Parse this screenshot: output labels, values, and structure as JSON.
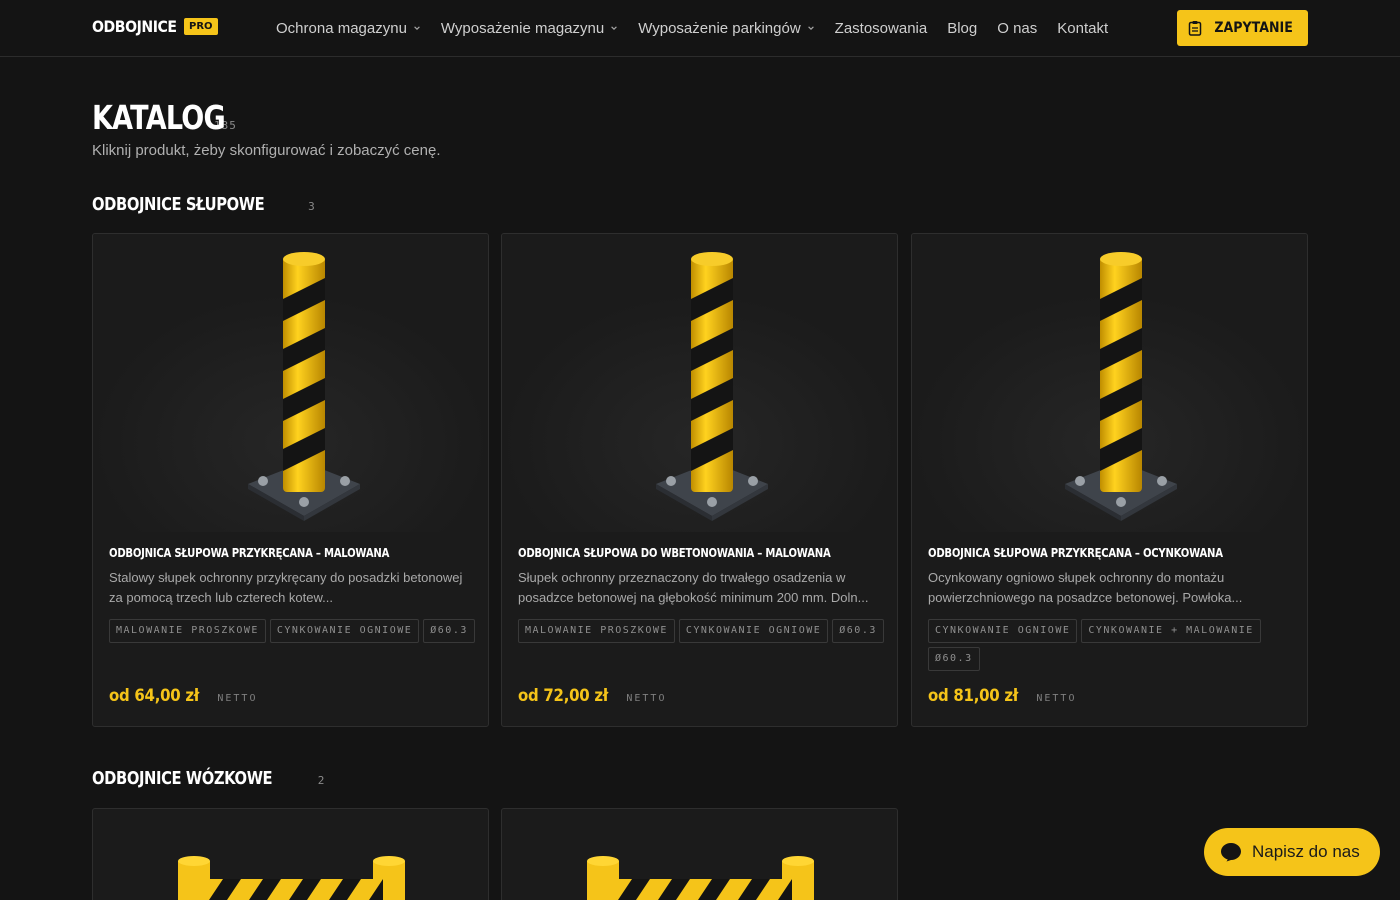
{
  "header": {
    "logo_text": "ODBOJNICE",
    "logo_badge": "PRO",
    "nav": [
      {
        "label": "Ochrona magazynu",
        "dropdown": true
      },
      {
        "label": "Wyposażenie magazynu",
        "dropdown": true
      },
      {
        "label": "Wyposażenie parkingów",
        "dropdown": true
      },
      {
        "label": "Zastosowania",
        "dropdown": false
      },
      {
        "label": "Blog",
        "dropdown": false
      },
      {
        "label": "O nas",
        "dropdown": false
      },
      {
        "label": "Kontakt",
        "dropdown": false
      }
    ],
    "cta_label": "ZAPYTANIE",
    "cta_icon": "clipboard-icon"
  },
  "page": {
    "title": "KATALOG",
    "count": "135",
    "subtitle": "Kliknij produkt, żeby skonfigurować i zobaczyć cenę."
  },
  "sections": [
    {
      "title": "ODBOJNICE SŁUPOWE",
      "count": "3",
      "products": [
        {
          "name": "ODBOJNICA SŁUPOWA PRZYKRĘCANA – MALOWANA",
          "description": "Stalowy słupek ochronny przykręcany do posadzki betonowej za pomocą trzech lub czterech kotew...",
          "tags": [
            "MALOWANIE PROSZKOWE",
            "CYNKOWANIE OGNIOWE",
            "Ø60.3"
          ],
          "price": "od 64,00 zł",
          "price_suffix": "NETTO"
        },
        {
          "name": "ODBOJNICA SŁUPOWA DO WBETONOWANIA – MALOWANA",
          "description": "Słupek ochronny przeznaczony do trwałego osadzenia w posadzce betonowej na głębokość minimum 200 mm. Doln...",
          "tags": [
            "MALOWANIE PROSZKOWE",
            "CYNKOWANIE OGNIOWE",
            "Ø60.3"
          ],
          "price": "od 72,00 zł",
          "price_suffix": "NETTO"
        },
        {
          "name": "ODBOJNICA SŁUPOWA PRZYKRĘCANA – OCYNKOWANA",
          "description": "Ocynkowany ogniowo słupek ochronny do montażu powierzchniowego na posadzce betonowej. Powłoka...",
          "tags": [
            "CYNKOWANIE OGNIOWE",
            "CYNKOWANIE + MALOWANIE",
            "Ø60.3"
          ],
          "price": "od 81,00 zł",
          "price_suffix": "NETTO"
        }
      ]
    },
    {
      "title": "ODBOJNICE WÓZKOWE",
      "count": "2"
    }
  ],
  "chat": {
    "label": "Napisz do nas",
    "icon": "chat-bubble-icon"
  },
  "colors": {
    "accent": "#f5c419",
    "background": "#141414",
    "card": "#1b1b1b"
  }
}
